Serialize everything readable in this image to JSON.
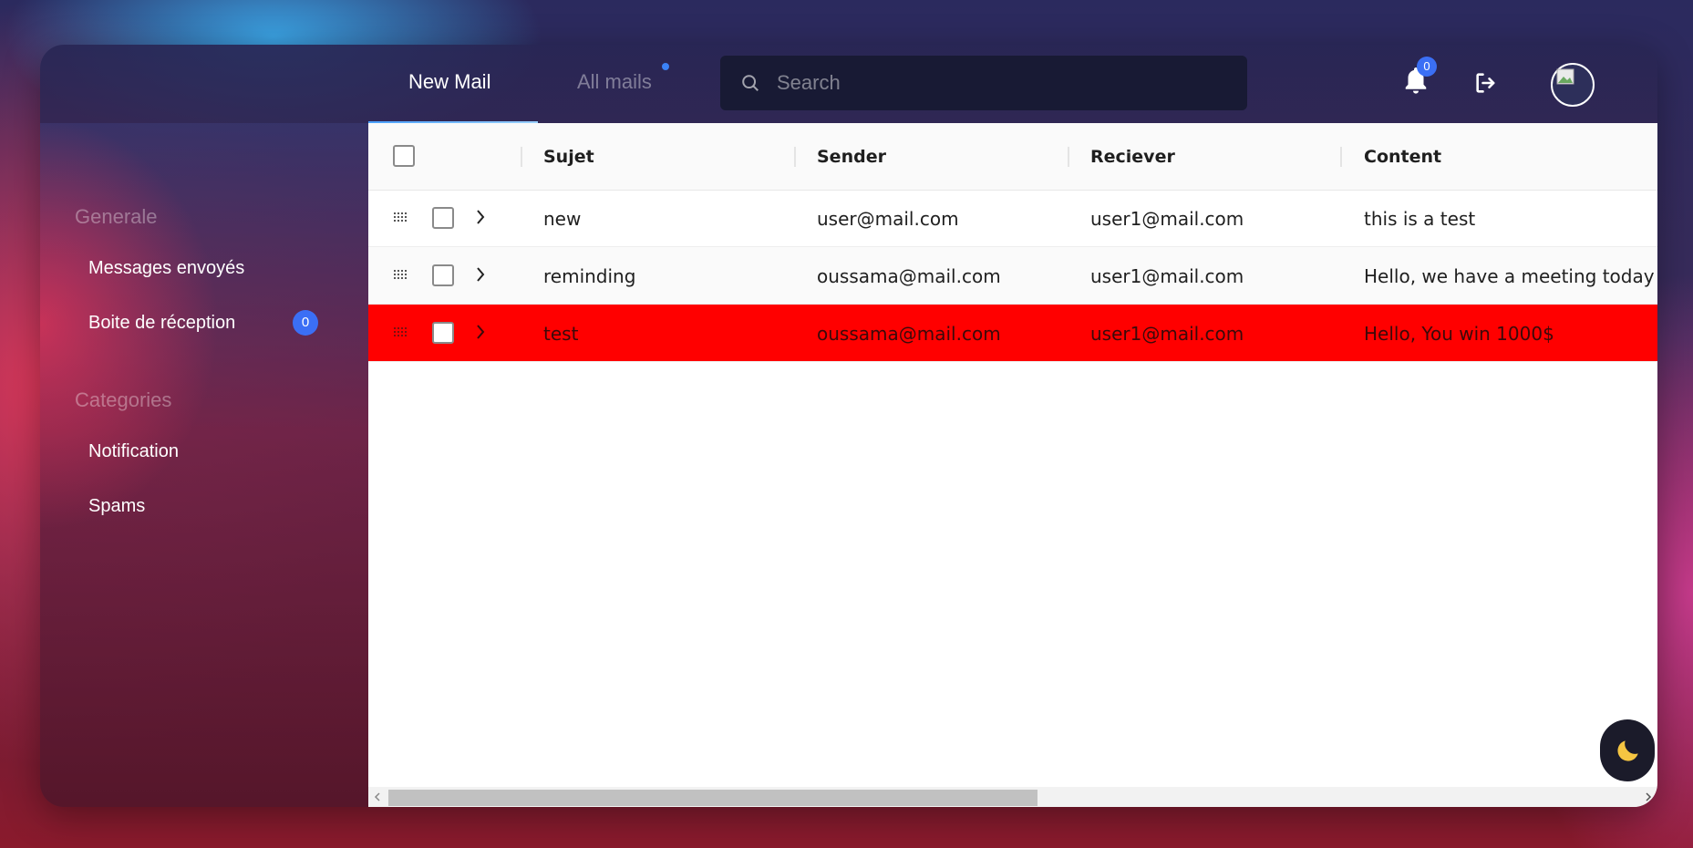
{
  "tabs": [
    {
      "label": "New Mail"
    },
    {
      "label": "All mails"
    }
  ],
  "search": {
    "placeholder": "Search"
  },
  "notifications": {
    "count": "0"
  },
  "sidebar": {
    "sections": [
      {
        "title": "Generale",
        "items": [
          {
            "label": "Messages envoyés"
          },
          {
            "label": "Boite de réception",
            "badge": "0"
          }
        ]
      },
      {
        "title": "Categories",
        "items": [
          {
            "label": "Notification"
          },
          {
            "label": "Spams"
          }
        ]
      }
    ]
  },
  "table": {
    "columns": [
      "Sujet",
      "Sender",
      "Reciever",
      "Content"
    ],
    "rows": [
      {
        "sujet": "new",
        "sender": "user@mail.com",
        "reciever": "user1@mail.com",
        "content": "this is a test"
      },
      {
        "sujet": "reminding",
        "sender": "oussama@mail.com",
        "reciever": "user1@mail.com",
        "content": "Hello, we have a meeting today a"
      },
      {
        "sujet": "test",
        "sender": "oussama@mail.com",
        "reciever": "user1@mail.com",
        "content": "Hello, You win 1000$",
        "highlighted": true
      }
    ]
  },
  "colors": {
    "accent": "#3b6ff5",
    "highlight_row": "#ff0000",
    "theme_icon": "#f5c542"
  },
  "icons": [
    "search-icon",
    "bell-icon",
    "logout-icon",
    "avatar",
    "drag-handle-icon",
    "chevron-right-icon",
    "moon-icon"
  ]
}
